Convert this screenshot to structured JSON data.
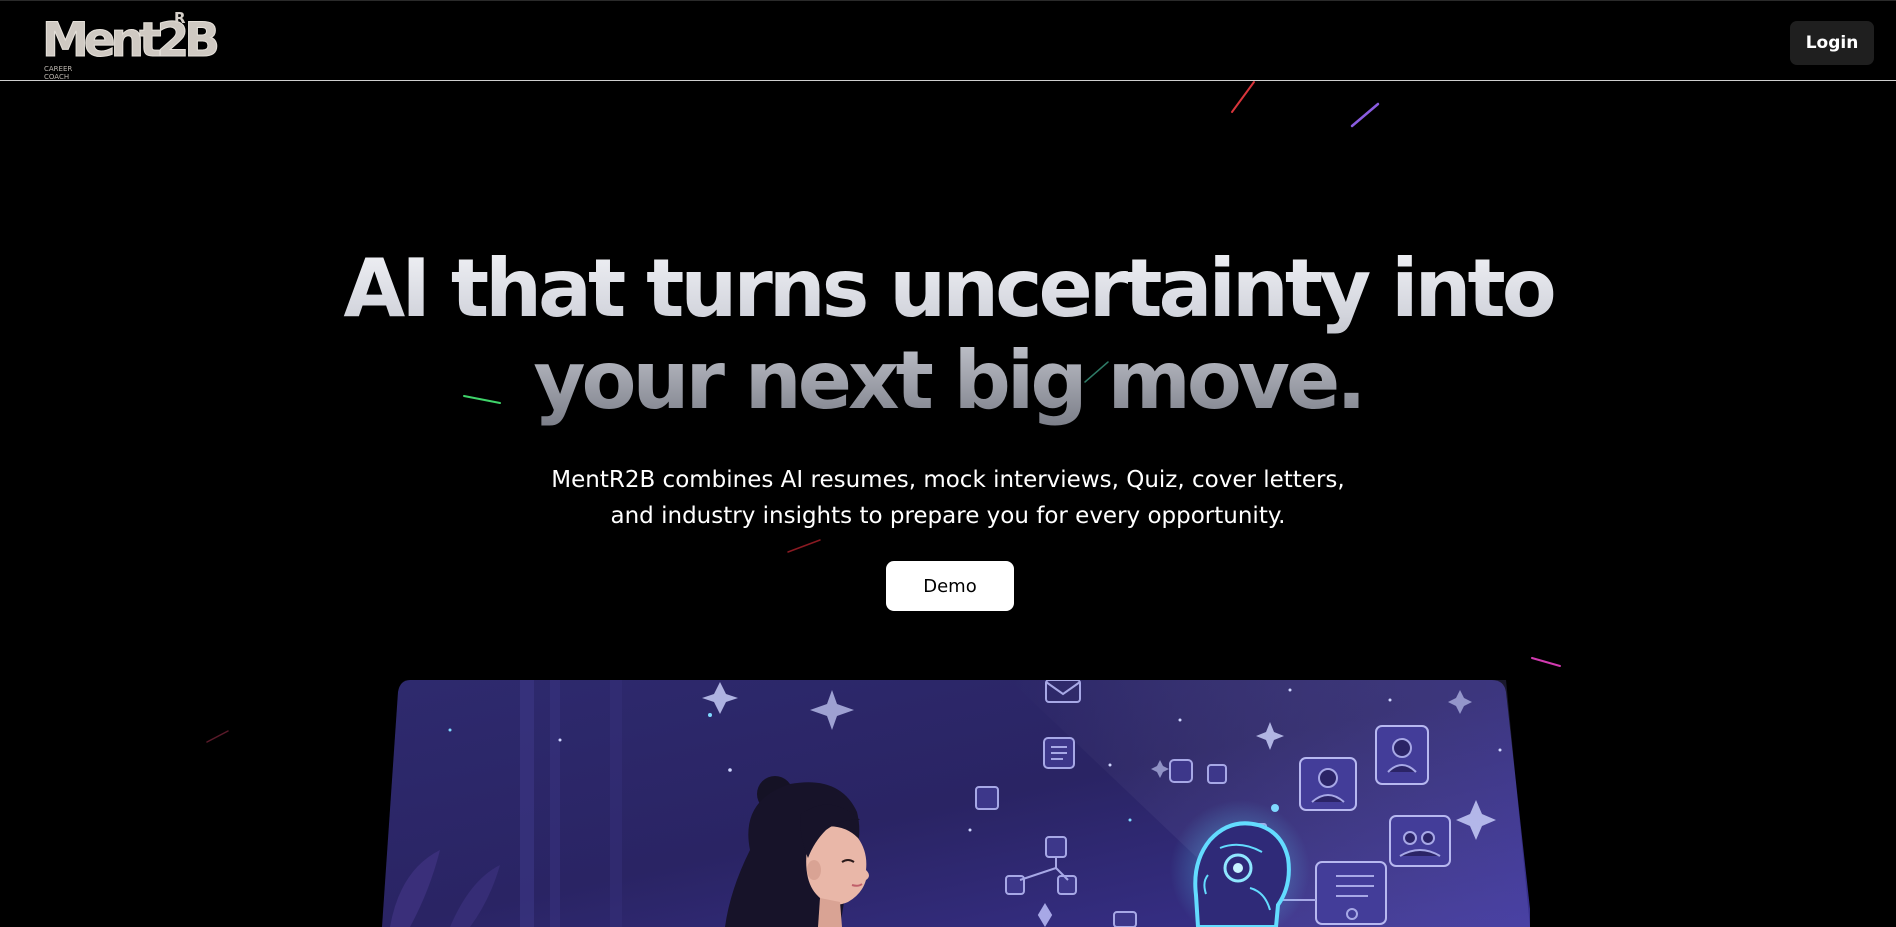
{
  "header": {
    "logo": {
      "main": "Ment2B",
      "superscript": "R",
      "tagline_line1": "CAREER",
      "tagline_line2": "COACH"
    },
    "login_label": "Login"
  },
  "hero": {
    "headline_line1": "AI that turns uncertainty into",
    "headline_line2": "your next big move.",
    "subtitle_line1": "MentR2B combines AI resumes, mock interviews, Quiz, cover letters,",
    "subtitle_line2": "and industry insights to prepare you for every opportunity.",
    "demo_label": "Demo"
  },
  "colors": {
    "background": "#000000",
    "headline_top": "#f2f3f7",
    "headline_bottom": "#7b7e88",
    "illustration_bg": "#2b2466",
    "accent_cyan": "#5fd7ff"
  }
}
